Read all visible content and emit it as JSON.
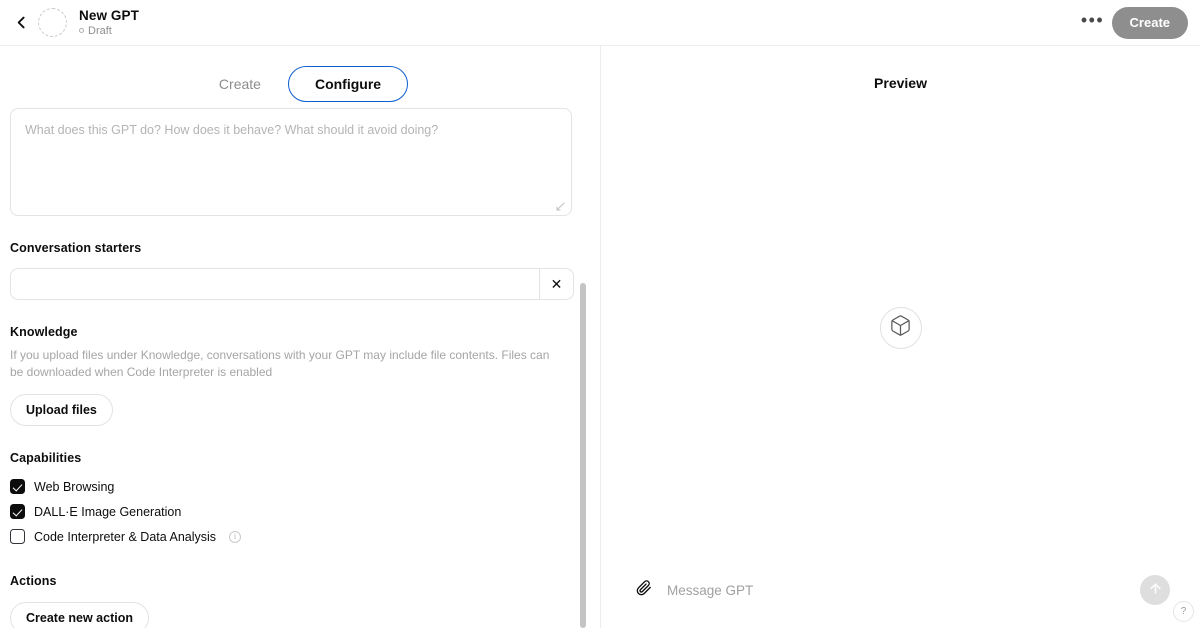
{
  "header": {
    "back_icon": "chevron-left-icon",
    "avatar_placeholder": "avatar-placeholder",
    "title": "New GPT",
    "status": "Draft",
    "more_label": "•••",
    "create_label": "Create"
  },
  "tabs": [
    {
      "id": "create",
      "label": "Create",
      "active": false
    },
    {
      "id": "configure",
      "label": "Configure",
      "active": true
    }
  ],
  "editor": {
    "instructions": {
      "value": "",
      "placeholder": "What does this GPT do? How does it behave? What should it avoid doing?"
    },
    "conversation_starters": {
      "title": "Conversation starters",
      "rows": [
        {
          "value": "",
          "placeholder": "",
          "remove_label": "✕"
        }
      ]
    },
    "knowledge": {
      "title": "Knowledge",
      "description": "If you upload files under Knowledge, conversations with your GPT may include file contents. Files can be downloaded when Code Interpreter is enabled",
      "upload_label": "Upload files"
    },
    "capabilities": {
      "title": "Capabilities",
      "items": [
        {
          "label": "Web Browsing",
          "checked": true,
          "info": false
        },
        {
          "label": "DALL·E Image Generation",
          "checked": true,
          "info": false
        },
        {
          "label": "Code Interpreter & Data Analysis",
          "checked": false,
          "info": true,
          "info_glyph": "i"
        }
      ]
    },
    "actions": {
      "title": "Actions",
      "create_label": "Create new action"
    }
  },
  "preview": {
    "title": "Preview",
    "empty_icon": "cube-icon",
    "composer": {
      "attach_icon": "paperclip-icon",
      "placeholder": "Message GPT",
      "value": "",
      "send_icon": "arrow-up-icon"
    },
    "help_label": "?"
  },
  "colors": {
    "accent_blue": "#0b5fd0",
    "create_button_bg": "#8e8e8e",
    "text_primary": "#0d0d0d",
    "text_muted": "#a5a5a5",
    "border": "#e3e3e3",
    "send_button_bg": "#dedede"
  }
}
